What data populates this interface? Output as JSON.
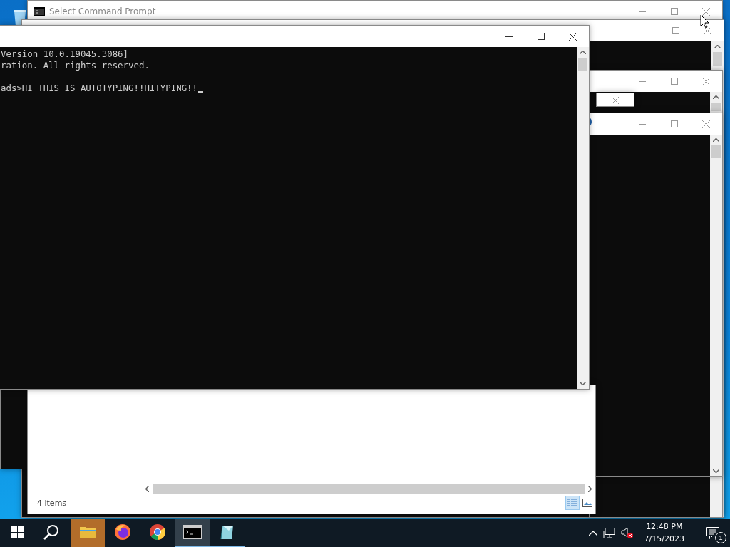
{
  "back_console": {
    "title": "Select Command Prompt"
  },
  "front_console": {
    "lines": [
      "Version 10.0.19045.3086]",
      "ration. All rights reserved."
    ],
    "prompt": "ads>HI THIS IS AUTOTYPING!!HITYPING!!",
    "cursor_visible": true
  },
  "explorer": {
    "status": "4 items",
    "views": [
      {
        "kind": "details",
        "selected": true
      },
      {
        "kind": "large-icons",
        "selected": false
      }
    ]
  },
  "taskbar": {
    "apps": [
      {
        "kind": "folder",
        "selected": false,
        "running": false,
        "flashing": true
      },
      {
        "kind": "firefox",
        "selected": false,
        "running": false,
        "flashing": false
      },
      {
        "kind": "chrome",
        "selected": false,
        "running": false,
        "flashing": false
      },
      {
        "kind": "console",
        "selected": true,
        "running": true,
        "flashing": false
      },
      {
        "kind": "notepad",
        "selected": false,
        "running": true,
        "flashing": false
      }
    ],
    "clock": {
      "time": "12:48 PM",
      "date": "7/15/2023"
    },
    "notifications": {
      "count": "1"
    }
  }
}
